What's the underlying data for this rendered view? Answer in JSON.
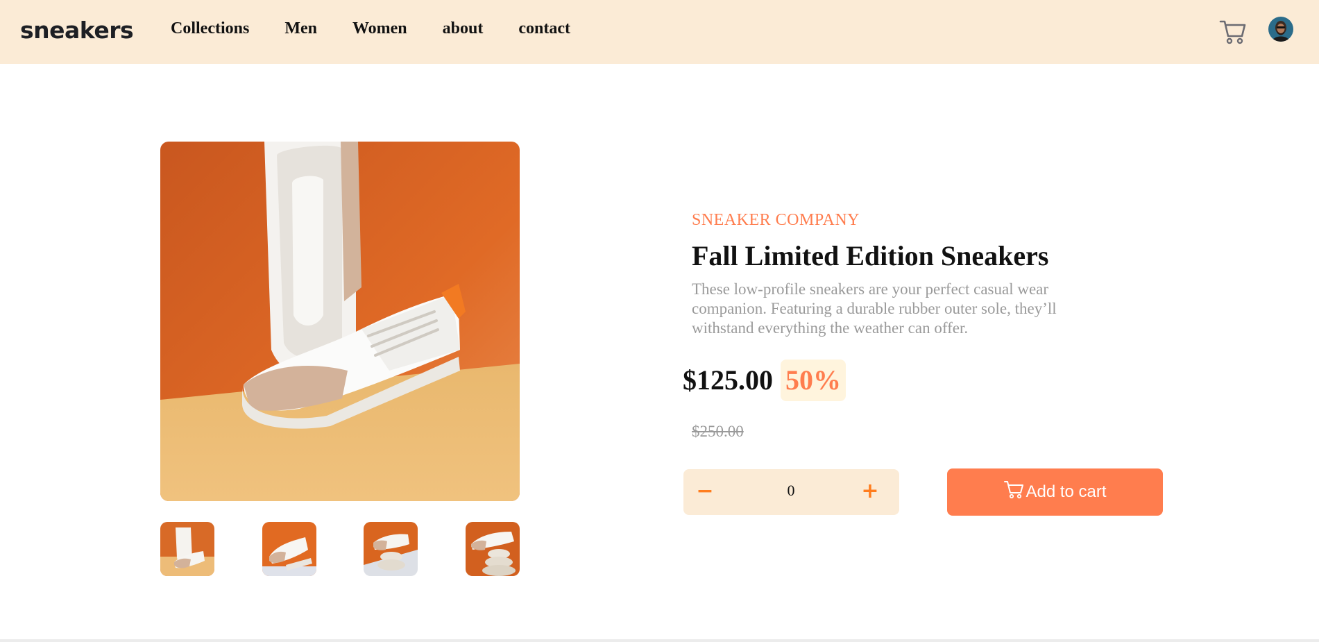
{
  "header": {
    "logo": "sneakers",
    "nav": [
      "Collections",
      "Men",
      "Women",
      "about",
      "contact"
    ]
  },
  "product": {
    "company": "SNEAKER COMPANY",
    "title": "Fall Limited Edition Sneakers",
    "description": "These low-profile sneakers are your perfect casual wear companion. Featuring a durable rubber outer sole, they’ll withstand everything the weather can offer.",
    "price": "$125.00",
    "discount": "50%",
    "old_price": "$250.00"
  },
  "cart": {
    "quantity": "0",
    "add_label": "Add to cart"
  },
  "colors": {
    "accent": "#ff7d4e",
    "header_bg": "#fbebd6",
    "discount_bg": "#fff4dd"
  },
  "icons": [
    "cart-icon",
    "avatar",
    "minus-icon",
    "plus-icon"
  ]
}
